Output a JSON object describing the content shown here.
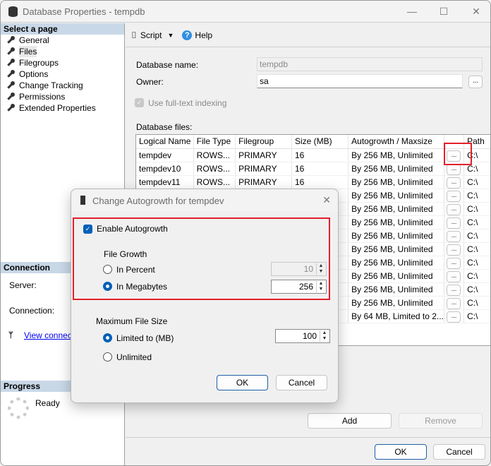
{
  "window": {
    "title": "Database Properties - tempdb",
    "minimize": "—",
    "maximize": "☐",
    "close": "✕"
  },
  "sidebar": {
    "select_header": "Select a page",
    "pages": [
      {
        "label": "General"
      },
      {
        "label": "Files",
        "selected": true
      },
      {
        "label": "Filegroups"
      },
      {
        "label": "Options"
      },
      {
        "label": "Change Tracking"
      },
      {
        "label": "Permissions"
      },
      {
        "label": "Extended Properties"
      }
    ],
    "connection_header": "Connection",
    "server_label": "Server:",
    "connection_label": "Connection:",
    "view_link": "View connection properties",
    "progress_header": "Progress",
    "progress_status": "Ready"
  },
  "toolbar": {
    "script_label": "Script",
    "help_label": "Help"
  },
  "form": {
    "dbname_label": "Database name:",
    "dbname_value": "tempdb",
    "owner_label": "Owner:",
    "owner_value": "sa",
    "owner_browse": "...",
    "fulltext_label": "Use full-text indexing",
    "files_label": "Database files:"
  },
  "grid": {
    "columns": [
      "Logical Name",
      "File Type",
      "Filegroup",
      "Size (MB)",
      "Autogrowth / Maxsize",
      "",
      "Path"
    ],
    "rows": [
      {
        "name": "tempdev",
        "type": "ROWS...",
        "fg": "PRIMARY",
        "size": "16",
        "auto": "By 256 MB, Unlimited",
        "path": "C:\\"
      },
      {
        "name": "tempdev10",
        "type": "ROWS...",
        "fg": "PRIMARY",
        "size": "16",
        "auto": "By 256 MB, Unlimited",
        "path": "C:\\"
      },
      {
        "name": "tempdev11",
        "type": "ROWS...",
        "fg": "PRIMARY",
        "size": "16",
        "auto": "By 256 MB, Unlimited",
        "path": "C:\\"
      },
      {
        "name": "",
        "type": "",
        "fg": "",
        "size": "",
        "auto": "By 256 MB, Unlimited",
        "path": "C:\\"
      },
      {
        "name": "",
        "type": "",
        "fg": "",
        "size": "",
        "auto": "By 256 MB, Unlimited",
        "path": "C:\\"
      },
      {
        "name": "",
        "type": "",
        "fg": "",
        "size": "",
        "auto": "By 256 MB, Unlimited",
        "path": "C:\\"
      },
      {
        "name": "",
        "type": "",
        "fg": "",
        "size": "",
        "auto": "By 256 MB, Unlimited",
        "path": "C:\\"
      },
      {
        "name": "",
        "type": "",
        "fg": "",
        "size": "",
        "auto": "By 256 MB, Unlimited",
        "path": "C:\\"
      },
      {
        "name": "",
        "type": "",
        "fg": "",
        "size": "",
        "auto": "By 256 MB, Unlimited",
        "path": "C:\\"
      },
      {
        "name": "",
        "type": "",
        "fg": "",
        "size": "",
        "auto": "By 256 MB, Unlimited",
        "path": "C:\\"
      },
      {
        "name": "",
        "type": "",
        "fg": "",
        "size": "",
        "auto": "By 256 MB, Unlimited",
        "path": "C:\\"
      },
      {
        "name": "",
        "type": "",
        "fg": "",
        "size": "",
        "auto": "By 256 MB, Unlimited",
        "path": "C:\\"
      },
      {
        "name": "",
        "type": "",
        "fg": "",
        "size": "",
        "auto": "By 64 MB, Limited to 2...",
        "path": "C:\\"
      }
    ],
    "browse_label": "..."
  },
  "buttons": {
    "add": "Add",
    "remove": "Remove",
    "ok": "OK",
    "cancel": "Cancel"
  },
  "dialog": {
    "title": "Change Autogrowth for tempdev",
    "close": "✕",
    "enable_label": "Enable Autogrowth",
    "file_growth_label": "File Growth",
    "in_percent_label": "In Percent",
    "percent_value": "10",
    "in_mb_label": "In Megabytes",
    "mb_value": "256",
    "max_size_label": "Maximum File Size",
    "limited_label": "Limited to (MB)",
    "limited_value": "100",
    "unlimited_label": "Unlimited",
    "ok": "OK",
    "cancel": "Cancel"
  },
  "colors": {
    "accent": "#005fb8",
    "highlight": "#e3202a",
    "section": "#c9d8e7"
  }
}
